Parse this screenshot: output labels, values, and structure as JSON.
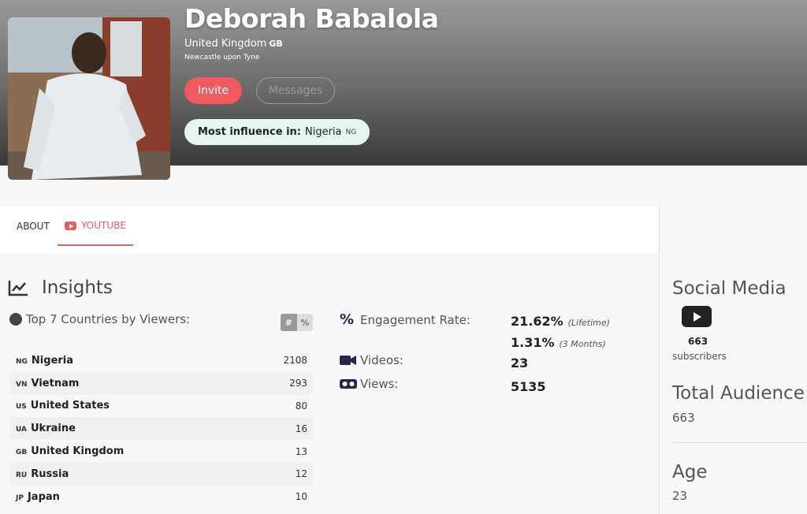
{
  "profile": {
    "name": "Deborah Babalola",
    "country": "United Kingdom",
    "country_code": "GB",
    "city": "Newcastle upon Tyne",
    "invite_label": "Invite",
    "messages_label": "Messages",
    "influence_label": "Most influence in:",
    "influence_country": "Nigeria",
    "influence_code": "NG"
  },
  "tabs": [
    {
      "label": "ABOUT",
      "active": false
    },
    {
      "label": "YOUTUBE",
      "active": true
    }
  ],
  "insights": {
    "title": "Insights",
    "countries_title": "Top 7 Countries by Viewers:",
    "toggle": [
      "#",
      "%"
    ],
    "countries": [
      {
        "code": "NG",
        "name": "Nigeria",
        "value": "2108"
      },
      {
        "code": "VN",
        "name": "Vietnam",
        "value": "293"
      },
      {
        "code": "US",
        "name": "United States",
        "value": "80"
      },
      {
        "code": "UA",
        "name": "Ukraine",
        "value": "16"
      },
      {
        "code": "GB",
        "name": "United Kingdom",
        "value": "13"
      },
      {
        "code": "RU",
        "name": "Russia",
        "value": "12"
      },
      {
        "code": "JP",
        "name": "Japan",
        "value": "10"
      }
    ],
    "engagement_label": "Engagement Rate:",
    "engagement_lifetime": "21.62%",
    "engagement_lifetime_note": "(Lifetime)",
    "engagement_3m": "1.31%",
    "engagement_3m_note": "(3 Months)",
    "videos_label": "Videos:",
    "videos_value": "23",
    "views_label": "Views:",
    "views_value": "5135"
  },
  "sidebar": {
    "social_title": "Social Media",
    "subscribers_count": "663",
    "subscribers_label": "subscribers",
    "audience_title": "Total Audience",
    "audience_value": "663",
    "age_title": "Age",
    "age_value": "23"
  },
  "colors": {
    "accent": "#ef5a5f",
    "influence_bg": "#e6f5f2",
    "icon_dark": "#2b2447"
  },
  "icons": [
    "trend-chart-icon",
    "globe-icon",
    "percent-icon",
    "video-camera-icon",
    "vr-glasses-icon",
    "youtube-icon"
  ]
}
